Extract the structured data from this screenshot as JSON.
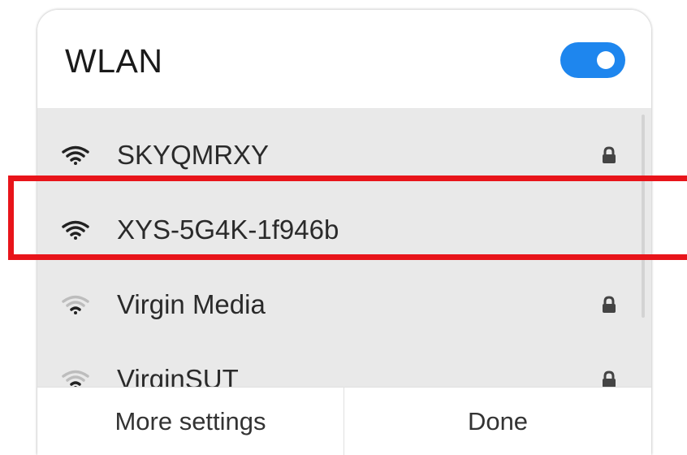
{
  "dialog": {
    "title": "WLAN",
    "toggle": {
      "state": "on",
      "color": "#1e86ee"
    }
  },
  "networks": [
    {
      "name": "SKYQMRXY",
      "signal": "strong",
      "secured": true,
      "icon": "wifi-icon"
    },
    {
      "name": "XYS-5G4K-1f946b",
      "signal": "strong",
      "secured": false,
      "icon": "wifi-icon"
    },
    {
      "name": "Virgin Media",
      "signal": "weak",
      "secured": true,
      "icon": "wifi-icon"
    },
    {
      "name": "VirginSUT",
      "signal": "weak",
      "secured": true,
      "icon": "wifi-icon"
    }
  ],
  "footer": {
    "more_settings_label": "More settings",
    "done_label": "Done"
  },
  "highlight": {
    "color": "#e8141a",
    "target": "XYS-5G4K-1f946b"
  }
}
